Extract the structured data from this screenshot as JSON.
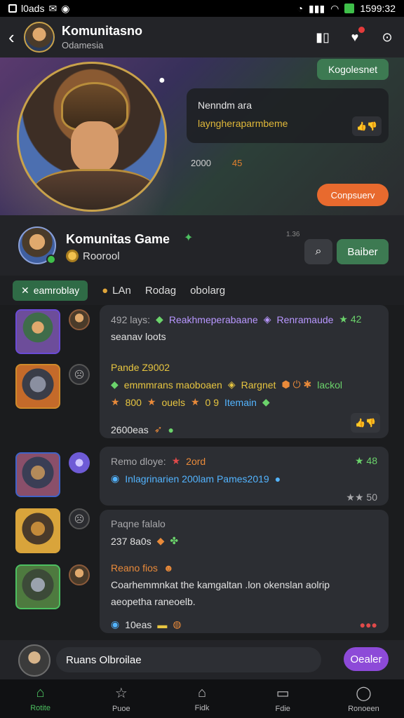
{
  "statusbar": {
    "left_text": "l0ads",
    "time": "1599:32"
  },
  "header": {
    "title": "Komunitasno",
    "subtitle": "Odamesia"
  },
  "hero": {
    "chip_green": "Kogolesnet",
    "card_line1": "Nenndm ara",
    "card_line2": "layngheraparmbeme",
    "stat_count": "2000",
    "stat_orange": "45",
    "chip_orange": "Conpsuerv"
  },
  "profile": {
    "name": "Komunitas Game",
    "role": "Roorool",
    "tiny": "1.36",
    "follow_label": "Baiber"
  },
  "tabs": [
    {
      "label": "eamroblay"
    },
    {
      "label": "LAn"
    },
    {
      "label": "Rodag"
    },
    {
      "label": "obolarg"
    }
  ],
  "posts": [
    {
      "line1_a": "492 lays:",
      "line1_b": "Reakhmeperabaane",
      "line1_c": "Renramaude",
      "line1_d": "42",
      "line2": "seanav loots",
      "line3": "Pande Z9002",
      "line4_a": "emmmrans maoboaen",
      "line4_b": "Rargnet",
      "line4_c": "lackol",
      "line5_a": "800",
      "line5_b": "ouels",
      "line5_c": "0 9",
      "line5_d": "Itemain",
      "count": "2600eas"
    },
    {
      "line1_a": "Remo dloye:",
      "line1_b": "2ord",
      "line1_c": "48",
      "line2": "Inlagrinarien 200lam Pames2019",
      "meta": "50"
    },
    {
      "line1": "Paqne falalo",
      "line2": "237 8a0s",
      "line3": "Reano fios",
      "line4": "Coarhemmnkat the kamgaltan .lon okenslan aolrip",
      "line5": "aeopetha raneoelb.",
      "count": "10eas"
    }
  ],
  "composer": {
    "placeholder": "Ruans Olbroilae",
    "send_label": "Oealer"
  },
  "bottom_nav": [
    {
      "label": "Rotite",
      "icon": "home-icon"
    },
    {
      "label": "Puoe",
      "icon": "star-icon"
    },
    {
      "label": "Fidk",
      "icon": "house-icon"
    },
    {
      "label": "Fdie",
      "icon": "screen-icon"
    },
    {
      "label": "Ronoeen",
      "icon": "user-icon"
    }
  ],
  "colors": {
    "accent_green": "#3d7a52",
    "accent_orange": "#e86a2e",
    "accent_purple": "#8d4ad8",
    "background": "#1b1c1e"
  }
}
